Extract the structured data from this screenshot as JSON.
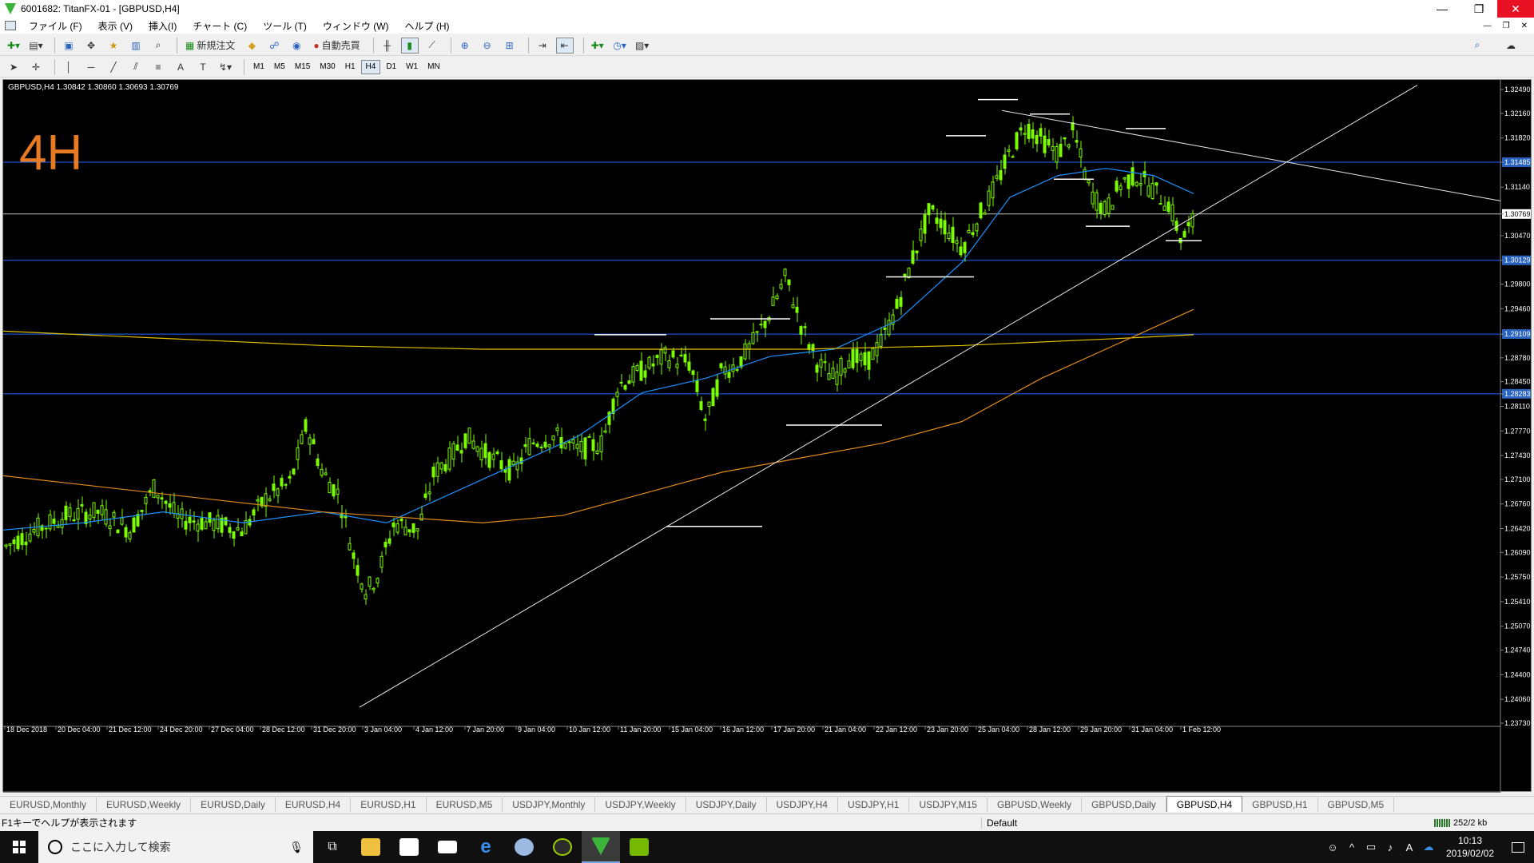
{
  "window": {
    "title": "6001682: TitanFX-01 - [GBPUSD,H4]"
  },
  "menu": [
    "ファイル (F)",
    "表示 (V)",
    "挿入(I)",
    "チャート (C)",
    "ツール (T)",
    "ウィンドウ (W)",
    "ヘルプ (H)"
  ],
  "toolbar1": {
    "new_order": "新規注文",
    "auto_trade": "自動売買"
  },
  "timeframes": [
    "M1",
    "M5",
    "M15",
    "M30",
    "H1",
    "H4",
    "D1",
    "W1",
    "MN"
  ],
  "active_timeframe": "H4",
  "chart": {
    "symbol_info": "GBPUSD,H4  1.30842 1.30860 1.30693 1.30769",
    "annotation": "4H",
    "price_axis": [
      "1.32490",
      "1.32160",
      "1.31820",
      "1.31485",
      "1.31140",
      "1.30769",
      "1.30470",
      "1.30129",
      "1.29800",
      "1.29460",
      "1.29109",
      "1.28780",
      "1.28450",
      "1.28283",
      "1.28110",
      "1.27770",
      "1.27430",
      "1.27100",
      "1.26760",
      "1.26420",
      "1.26090",
      "1.25750",
      "1.25410",
      "1.25070",
      "1.24740",
      "1.24400",
      "1.24060",
      "1.23730"
    ],
    "highlight_prices": [
      "1.31485",
      "1.30769",
      "1.30129",
      "1.29109",
      "1.28283"
    ],
    "time_axis": [
      "18 Dec 2018",
      "20 Dec 04:00",
      "21 Dec 12:00",
      "24 Dec 20:00",
      "27 Dec 04:00",
      "28 Dec 12:00",
      "31 Dec 20:00",
      "3 Jan 04:00",
      "4 Jan 12:00",
      "7 Jan 20:00",
      "9 Jan 04:00",
      "10 Jan 12:00",
      "11 Jan 20:00",
      "15 Jan 04:00",
      "16 Jan 12:00",
      "17 Jan 20:00",
      "21 Jan 04:00",
      "22 Jan 12:00",
      "23 Jan 20:00",
      "25 Jan 04:00",
      "28 Jan 12:00",
      "29 Jan 20:00",
      "31 Jan 04:00",
      "1 Feb 12:00"
    ],
    "colors": {
      "background": "#000000",
      "bull": "#7cfc00",
      "bear": "#7cfc00",
      "ma_fast": "#1e90ff",
      "ma_mid": "#e0c000",
      "ma_slow": "#e08a1e",
      "hline": "#2266ff",
      "current": "#c0c0c0"
    }
  },
  "tabs": [
    "EURUSD,Monthly",
    "EURUSD,Weekly",
    "EURUSD,Daily",
    "EURUSD,H4",
    "EURUSD,H1",
    "EURUSD,M5",
    "USDJPY,Monthly",
    "USDJPY,Weekly",
    "USDJPY,Daily",
    "USDJPY,H4",
    "USDJPY,H1",
    "USDJPY,M15",
    "GBPUSD,Weekly",
    "GBPUSD,Daily",
    "GBPUSD,H4",
    "GBPUSD,H1",
    "GBPUSD,M5"
  ],
  "active_tab": "GBPUSD,H4",
  "status": {
    "help": "F1キーでヘルプが表示されます",
    "profile": "Default",
    "traffic": "252/2 kb"
  },
  "taskbar": {
    "search_placeholder": "ここに入力して検索",
    "time": "10:13",
    "date": "2019/02/02"
  }
}
